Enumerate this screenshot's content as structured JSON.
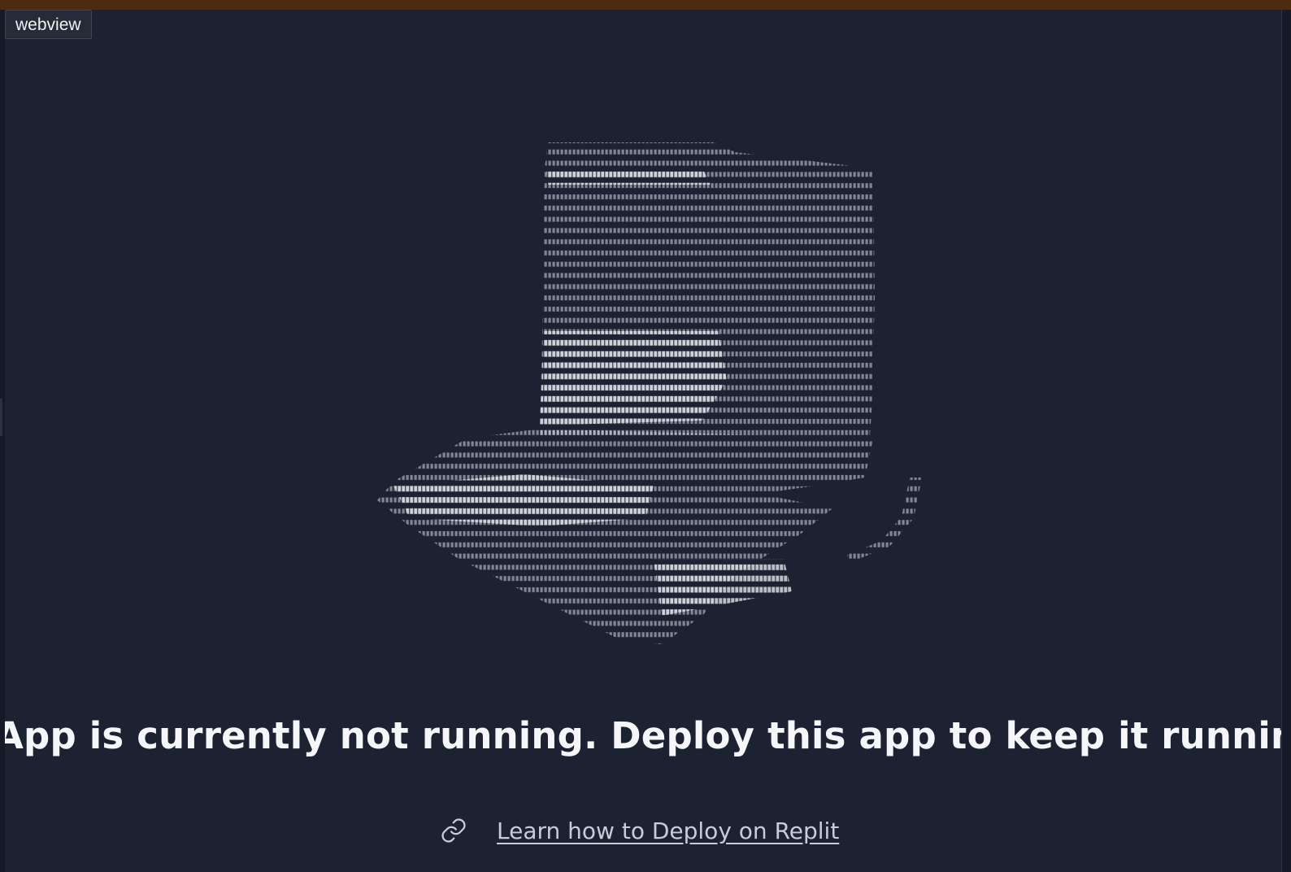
{
  "webview_tab": {
    "label": "webview"
  },
  "main": {
    "headline": "App is currently not running. Deploy this app to keep it running externally.",
    "link_text": "Learn how to Deploy on Replit",
    "link_icon": "link-icon",
    "illustration_icon": "ascii-art-top-hat"
  },
  "colors": {
    "background": "#1c2232",
    "top_bar": "#4e2b0e",
    "headline_text": "#f5f6f8",
    "link_text": "#c8ccd6",
    "ascii_art": "#d6d9e0"
  }
}
